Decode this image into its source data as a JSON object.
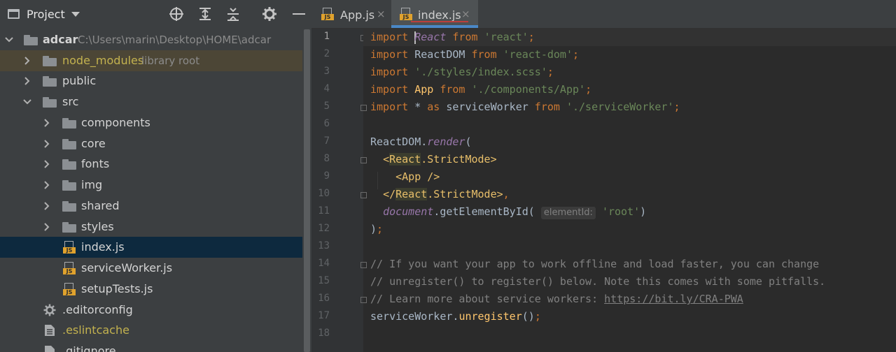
{
  "sidebar": {
    "title": "Project",
    "root": {
      "name": "adcar",
      "path": "C:\\Users\\marin\\Desktop\\HOME\\adcar"
    },
    "node_modules": {
      "name": "node_modules",
      "note": "library root"
    },
    "items": [
      {
        "label": "public"
      },
      {
        "label": "src"
      },
      {
        "label": "components"
      },
      {
        "label": "core"
      },
      {
        "label": "fonts"
      },
      {
        "label": "img"
      },
      {
        "label": "shared"
      },
      {
        "label": "styles"
      },
      {
        "label": "index.js"
      },
      {
        "label": "serviceWorker.js"
      },
      {
        "label": "setupTests.js"
      },
      {
        "label": ".editorconfig"
      },
      {
        "label": ".eslintcache"
      },
      {
        "label": ".gitignore"
      }
    ]
  },
  "tabs": [
    {
      "label": "App.js",
      "close": "×"
    },
    {
      "label": "index.js",
      "close": "×"
    }
  ],
  "editor": {
    "line_numbers": [
      "1",
      "2",
      "3",
      "4",
      "5",
      "6",
      "7",
      "8",
      "9",
      "10",
      "11",
      "12",
      "13",
      "14",
      "15",
      "16",
      "17",
      "18"
    ],
    "hint_element_id": "elementId:"
  },
  "colors": {
    "accent": "#4a88c7",
    "js_badge": "#e0a22d",
    "selection": "#0d293e"
  }
}
